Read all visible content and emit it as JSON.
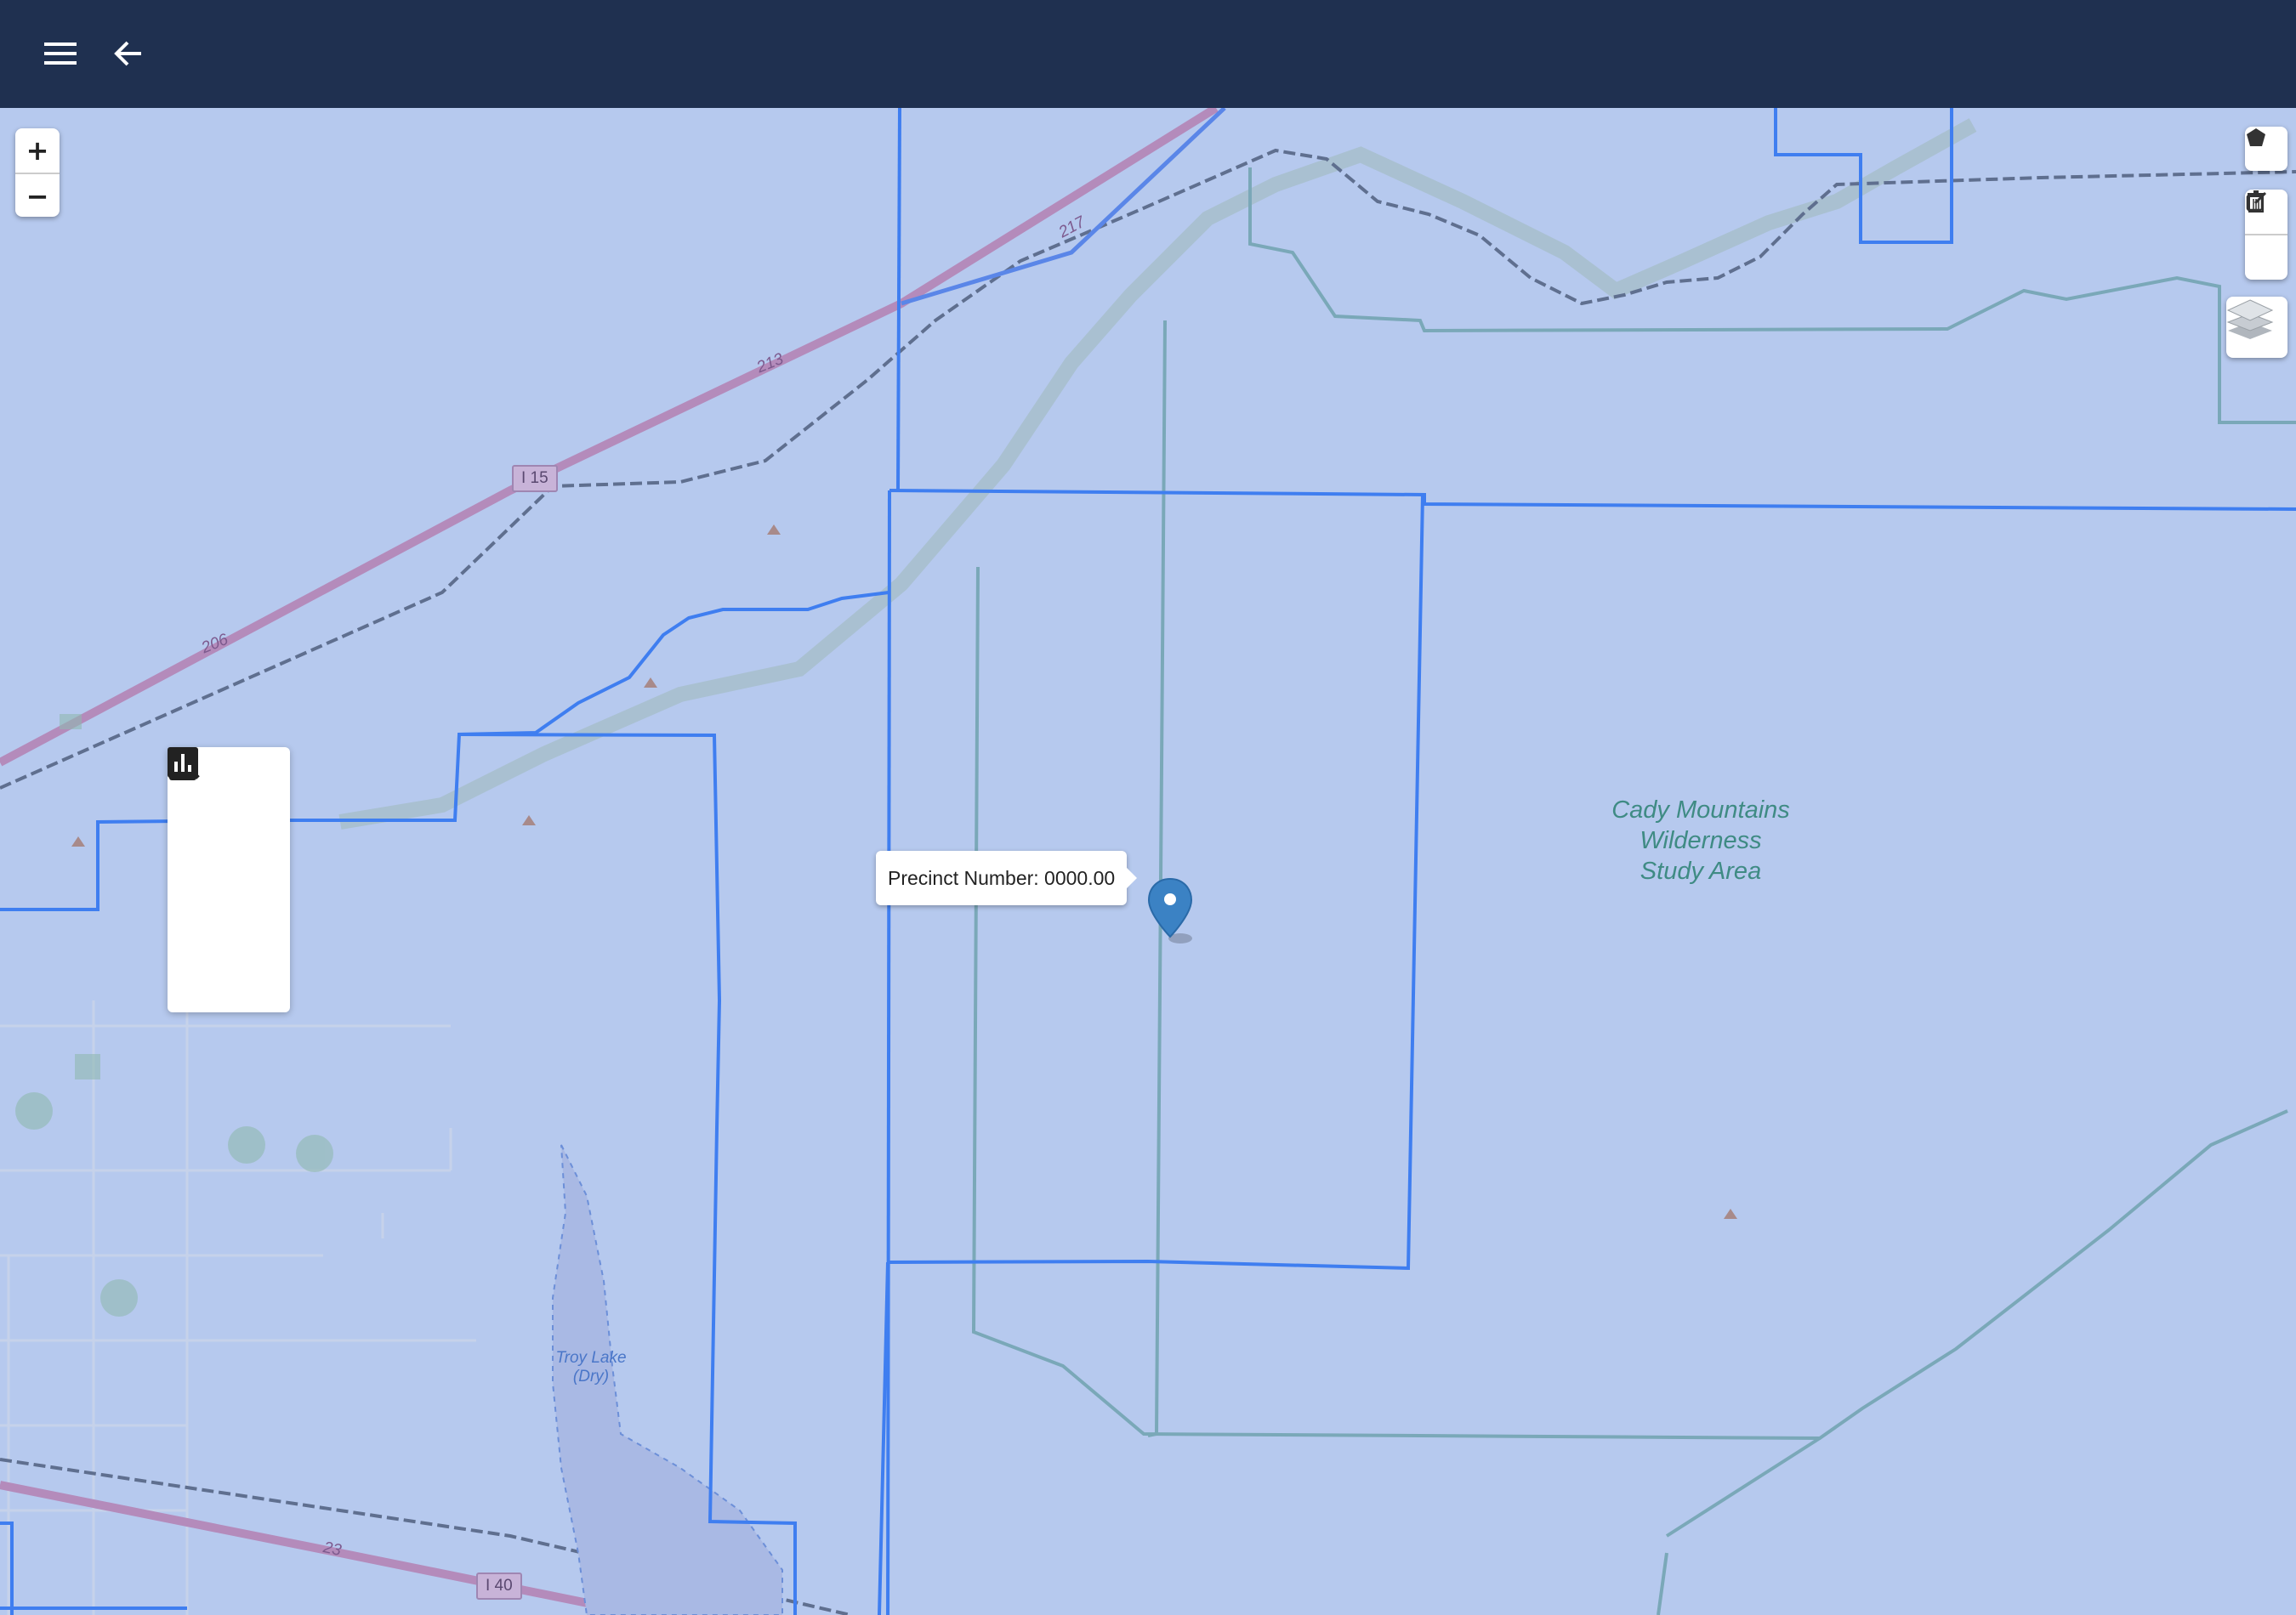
{
  "topbar": {
    "menu_icon": "menu-icon",
    "back_icon": "arrow-back-icon"
  },
  "map_controls": {
    "zoom_in_label": "+",
    "zoom_out_label": "−",
    "draw_polygon_icon": "polygon-icon",
    "edit_icon": "edit-icon",
    "delete_icon": "trash-icon",
    "layers_icon": "layers-icon"
  },
  "tool_panel": {
    "items": [
      {
        "icon": "search-icon"
      },
      {
        "icon": "clipboard-icon"
      },
      {
        "icon": "bar-chart-icon"
      }
    ]
  },
  "popup": {
    "text": "Precinct Number: 0000.00"
  },
  "map_labels": {
    "wilderness_line1": "Cady Mountains",
    "wilderness_line2": "Wilderness",
    "wilderness_line3": "Study Area",
    "lake_line1": "Troy Lake",
    "lake_line2": "(Dry)",
    "i15": "I 15",
    "i40": "I 40",
    "route_217": "217",
    "route_213": "213",
    "route_206": "206",
    "route_23": "23"
  },
  "colors": {
    "header": "#1f3050",
    "map_background": "#b6c9ee",
    "precinct_boundary": "#3f7ef0",
    "wilderness_boundary": "#7aa8b8",
    "highway": "#b48bbb",
    "marker": "#3b82c4"
  }
}
